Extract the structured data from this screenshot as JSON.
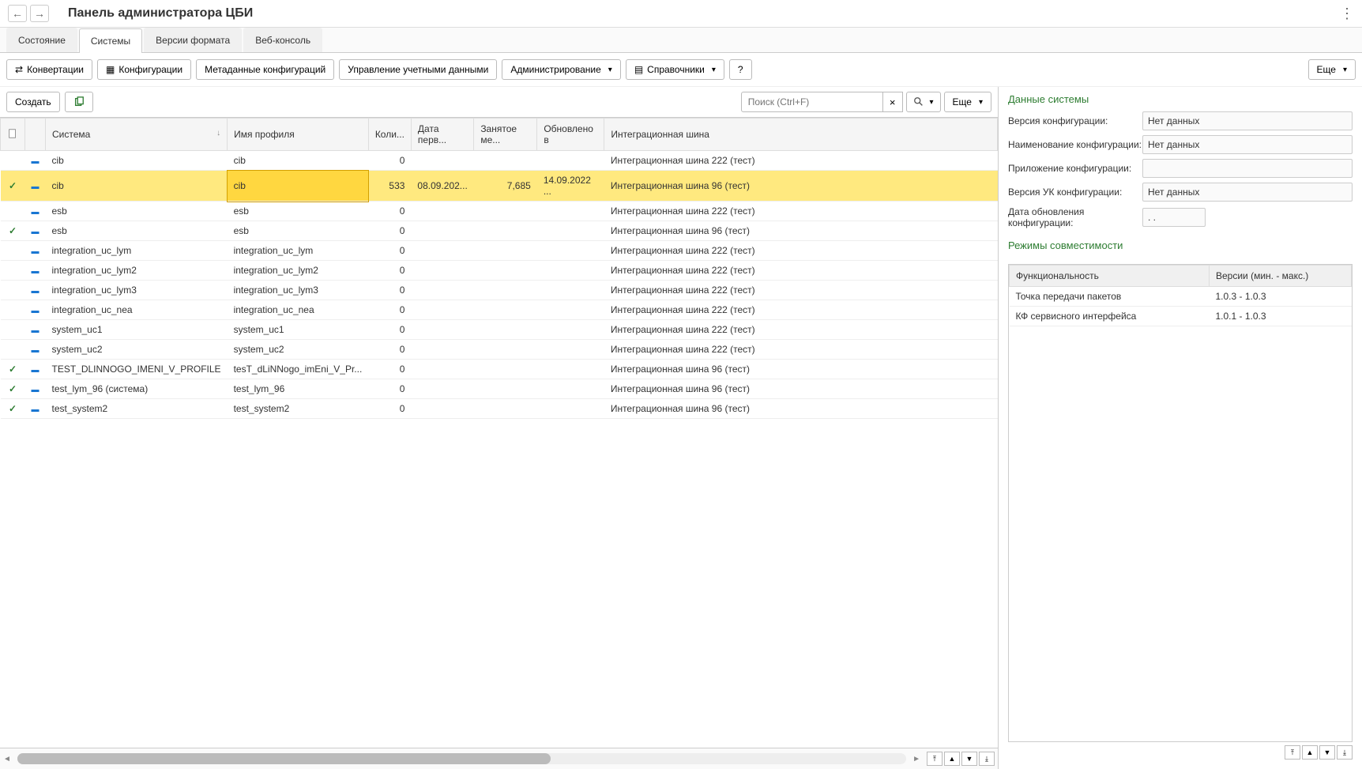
{
  "title": "Панель администратора ЦБИ",
  "tabs": [
    "Состояние",
    "Системы",
    "Версии формата",
    "Веб-консоль"
  ],
  "active_tab": 1,
  "toolbar": {
    "convert": "Конвертации",
    "config": "Конфигурации",
    "metadata": "Метаданные конфигураций",
    "creds": "Управление учетными данными",
    "admin": "Администрирование",
    "refs": "Справочники",
    "help": "?",
    "more": "Еще"
  },
  "sub_toolbar": {
    "create": "Создать",
    "search_placeholder": "Поиск (Ctrl+F)",
    "more": "Еще"
  },
  "columns": {
    "system": "Система",
    "profile": "Имя профиля",
    "count": "Коли...",
    "date_first": "Дата перв...",
    "space": "Занятое ме...",
    "updated": "Обновлено в",
    "bus": "Интеграционная шина"
  },
  "rows": [
    {
      "check": false,
      "system": "cib",
      "profile": "cib",
      "count": "0",
      "date": "",
      "space": "",
      "updated": "",
      "bus": "Интеграционная шина 222 (тест)"
    },
    {
      "check": true,
      "selected": true,
      "system": "cib",
      "profile": "cib",
      "count": "533",
      "date": "08.09.202...",
      "space": "7,685",
      "updated": "14.09.2022 ...",
      "bus": "Интеграционная шина 96 (тест)"
    },
    {
      "check": false,
      "system": "esb",
      "profile": "esb",
      "count": "0",
      "date": "",
      "space": "",
      "updated": "",
      "bus": "Интеграционная шина 222 (тест)"
    },
    {
      "check": true,
      "system": "esb",
      "profile": "esb",
      "count": "0",
      "date": "",
      "space": "",
      "updated": "",
      "bus": "Интеграционная шина 96 (тест)"
    },
    {
      "check": false,
      "system": "integration_uc_lym",
      "profile": "integration_uc_lym",
      "count": "0",
      "date": "",
      "space": "",
      "updated": "",
      "bus": "Интеграционная шина 222 (тест)"
    },
    {
      "check": false,
      "system": "integration_uc_lym2",
      "profile": "integration_uc_lym2",
      "count": "0",
      "date": "",
      "space": "",
      "updated": "",
      "bus": "Интеграционная шина 222 (тест)"
    },
    {
      "check": false,
      "system": "integration_uc_lym3",
      "profile": "integration_uc_lym3",
      "count": "0",
      "date": "",
      "space": "",
      "updated": "",
      "bus": "Интеграционная шина 222 (тест)"
    },
    {
      "check": false,
      "system": "integration_uc_nea",
      "profile": "integration_uc_nea",
      "count": "0",
      "date": "",
      "space": "",
      "updated": "",
      "bus": "Интеграционная шина 222 (тест)"
    },
    {
      "check": false,
      "system": "system_uc1",
      "profile": "system_uc1",
      "count": "0",
      "date": "",
      "space": "",
      "updated": "",
      "bus": "Интеграционная шина 222 (тест)"
    },
    {
      "check": false,
      "system": "system_uc2",
      "profile": "system_uc2",
      "count": "0",
      "date": "",
      "space": "",
      "updated": "",
      "bus": "Интеграционная шина 222 (тест)"
    },
    {
      "check": true,
      "system": "TEST_DLINNOGO_IMENI_V_PROFILE",
      "profile": "tesT_dLiNNogo_imEni_V_Pr...",
      "count": "0",
      "date": "",
      "space": "",
      "updated": "",
      "bus": "Интеграционная шина 96 (тест)"
    },
    {
      "check": true,
      "system": "test_lym_96 (система)",
      "profile": "test_lym_96",
      "count": "0",
      "date": "",
      "space": "",
      "updated": "",
      "bus": "Интеграционная шина 96 (тест)"
    },
    {
      "check": true,
      "system": "test_system2",
      "profile": "test_system2",
      "count": "0",
      "date": "",
      "space": "",
      "updated": "",
      "bus": "Интеграционная шина 96 (тест)"
    }
  ],
  "right": {
    "section1": "Данные системы",
    "version_label": "Версия конфигурации:",
    "version_value": "Нет данных",
    "name_label": "Наименование конфигурации:",
    "name_value": "Нет данных",
    "app_label": "Приложение конфигурации:",
    "app_value": "",
    "uk_label": "Версия УК конфигурации:",
    "uk_value": "Нет данных",
    "date_label": "Дата обновления конфигурации:",
    "date_value": "  .  .  ",
    "section2": "Режимы совместимости",
    "compat_col1": "Функциональность",
    "compat_col2": "Версии (мин. - макс.)",
    "compat_rows": [
      {
        "func": "Точка передачи пакетов",
        "ver": "1.0.3 - 1.0.3"
      },
      {
        "func": "КФ сервисного интерфейса",
        "ver": "1.0.1 - 1.0.3"
      }
    ]
  }
}
